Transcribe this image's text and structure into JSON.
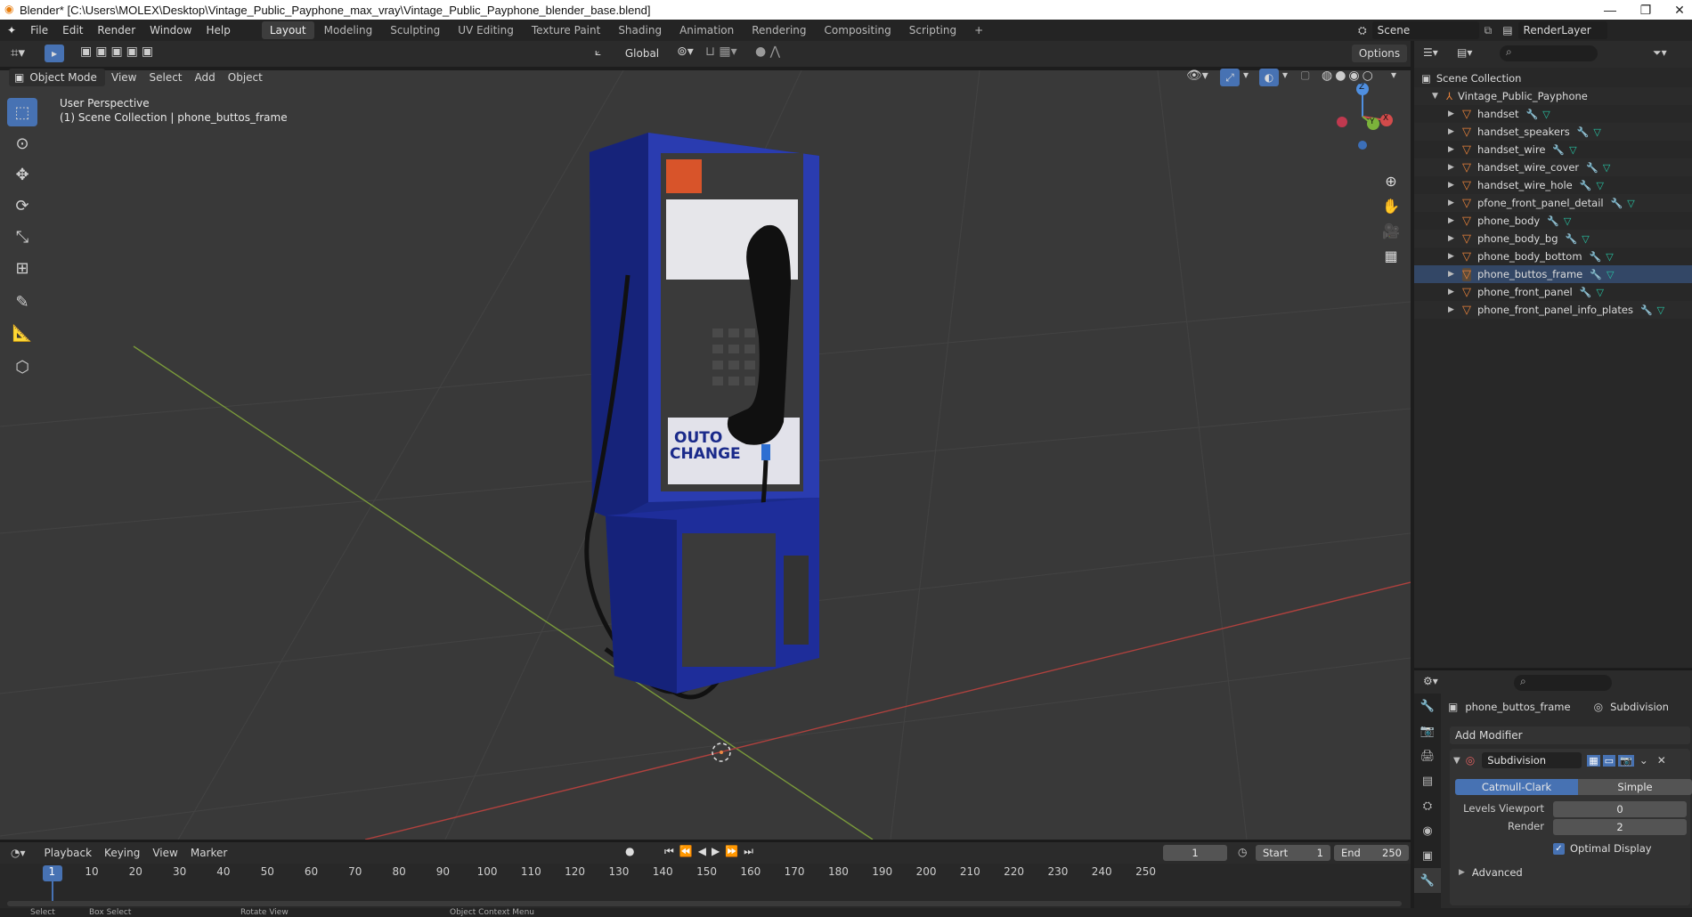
{
  "window": {
    "title": "Blender* [C:\\Users\\MOLEX\\Desktop\\Vintage_Public_Payphone_max_vray\\Vintage_Public_Payphone_blender_base.blend]",
    "minimize": "—",
    "restore": "❐",
    "close": "✕"
  },
  "menu": [
    "File",
    "Edit",
    "Render",
    "Window",
    "Help"
  ],
  "workspaces": [
    "Layout",
    "Modeling",
    "Sculpting",
    "UV Editing",
    "Texture Paint",
    "Shading",
    "Animation",
    "Rendering",
    "Compositing",
    "Scripting",
    "+"
  ],
  "scene": {
    "name": "Scene",
    "render_layer": "RenderLayer"
  },
  "viewport_header": {
    "orientation": "Global",
    "options": "Options",
    "mode": "Object Mode",
    "menus": [
      "View",
      "Select",
      "Add",
      "Object"
    ]
  },
  "viewport": {
    "perspective": "User Perspective",
    "collection_info": "(1) Scene Collection | phone_buttos_frame",
    "gizmo": {
      "x": "X",
      "y": "Y",
      "z": "Z"
    }
  },
  "outliner": {
    "root": "Scene Collection",
    "collection": "Vintage_Public_Payphone",
    "items": [
      "handset",
      "handset_speakers",
      "handset_wire",
      "handset_wire_cover",
      "handset_wire_hole",
      "pfone_front_panel_detail",
      "phone_body",
      "phone_body_bg",
      "phone_body_bottom",
      "phone_buttos_frame",
      "phone_front_panel",
      "phone_front_panel_info_plates"
    ]
  },
  "properties": {
    "object": "phone_buttos_frame",
    "modifier_tab": "Subdivision",
    "add_modifier": "Add Modifier",
    "modifier_name": "Subdivision",
    "algo": [
      "Catmull-Clark",
      "Simple"
    ],
    "levels_viewport_label": "Levels Viewport",
    "levels_viewport": "0",
    "render_label": "Render",
    "render": "2",
    "optimal_display": "Optimal Display",
    "advanced": "Advanced"
  },
  "timeline": {
    "menus": [
      "Playback",
      "Keying",
      "View",
      "Marker"
    ],
    "current_frame": "1",
    "start_label": "Start",
    "start": "1",
    "end_label": "End",
    "end": "250",
    "ticks": [
      "1",
      "10",
      "20",
      "30",
      "40",
      "50",
      "60",
      "70",
      "80",
      "90",
      "100",
      "110",
      "120",
      "130",
      "140",
      "150",
      "160",
      "170",
      "180",
      "190",
      "200",
      "210",
      "220",
      "230",
      "240",
      "250"
    ]
  },
  "status": {
    "select": "Select",
    "box_select": "Box Select",
    "rotate": "Rotate View",
    "context": "Object Context Menu"
  }
}
